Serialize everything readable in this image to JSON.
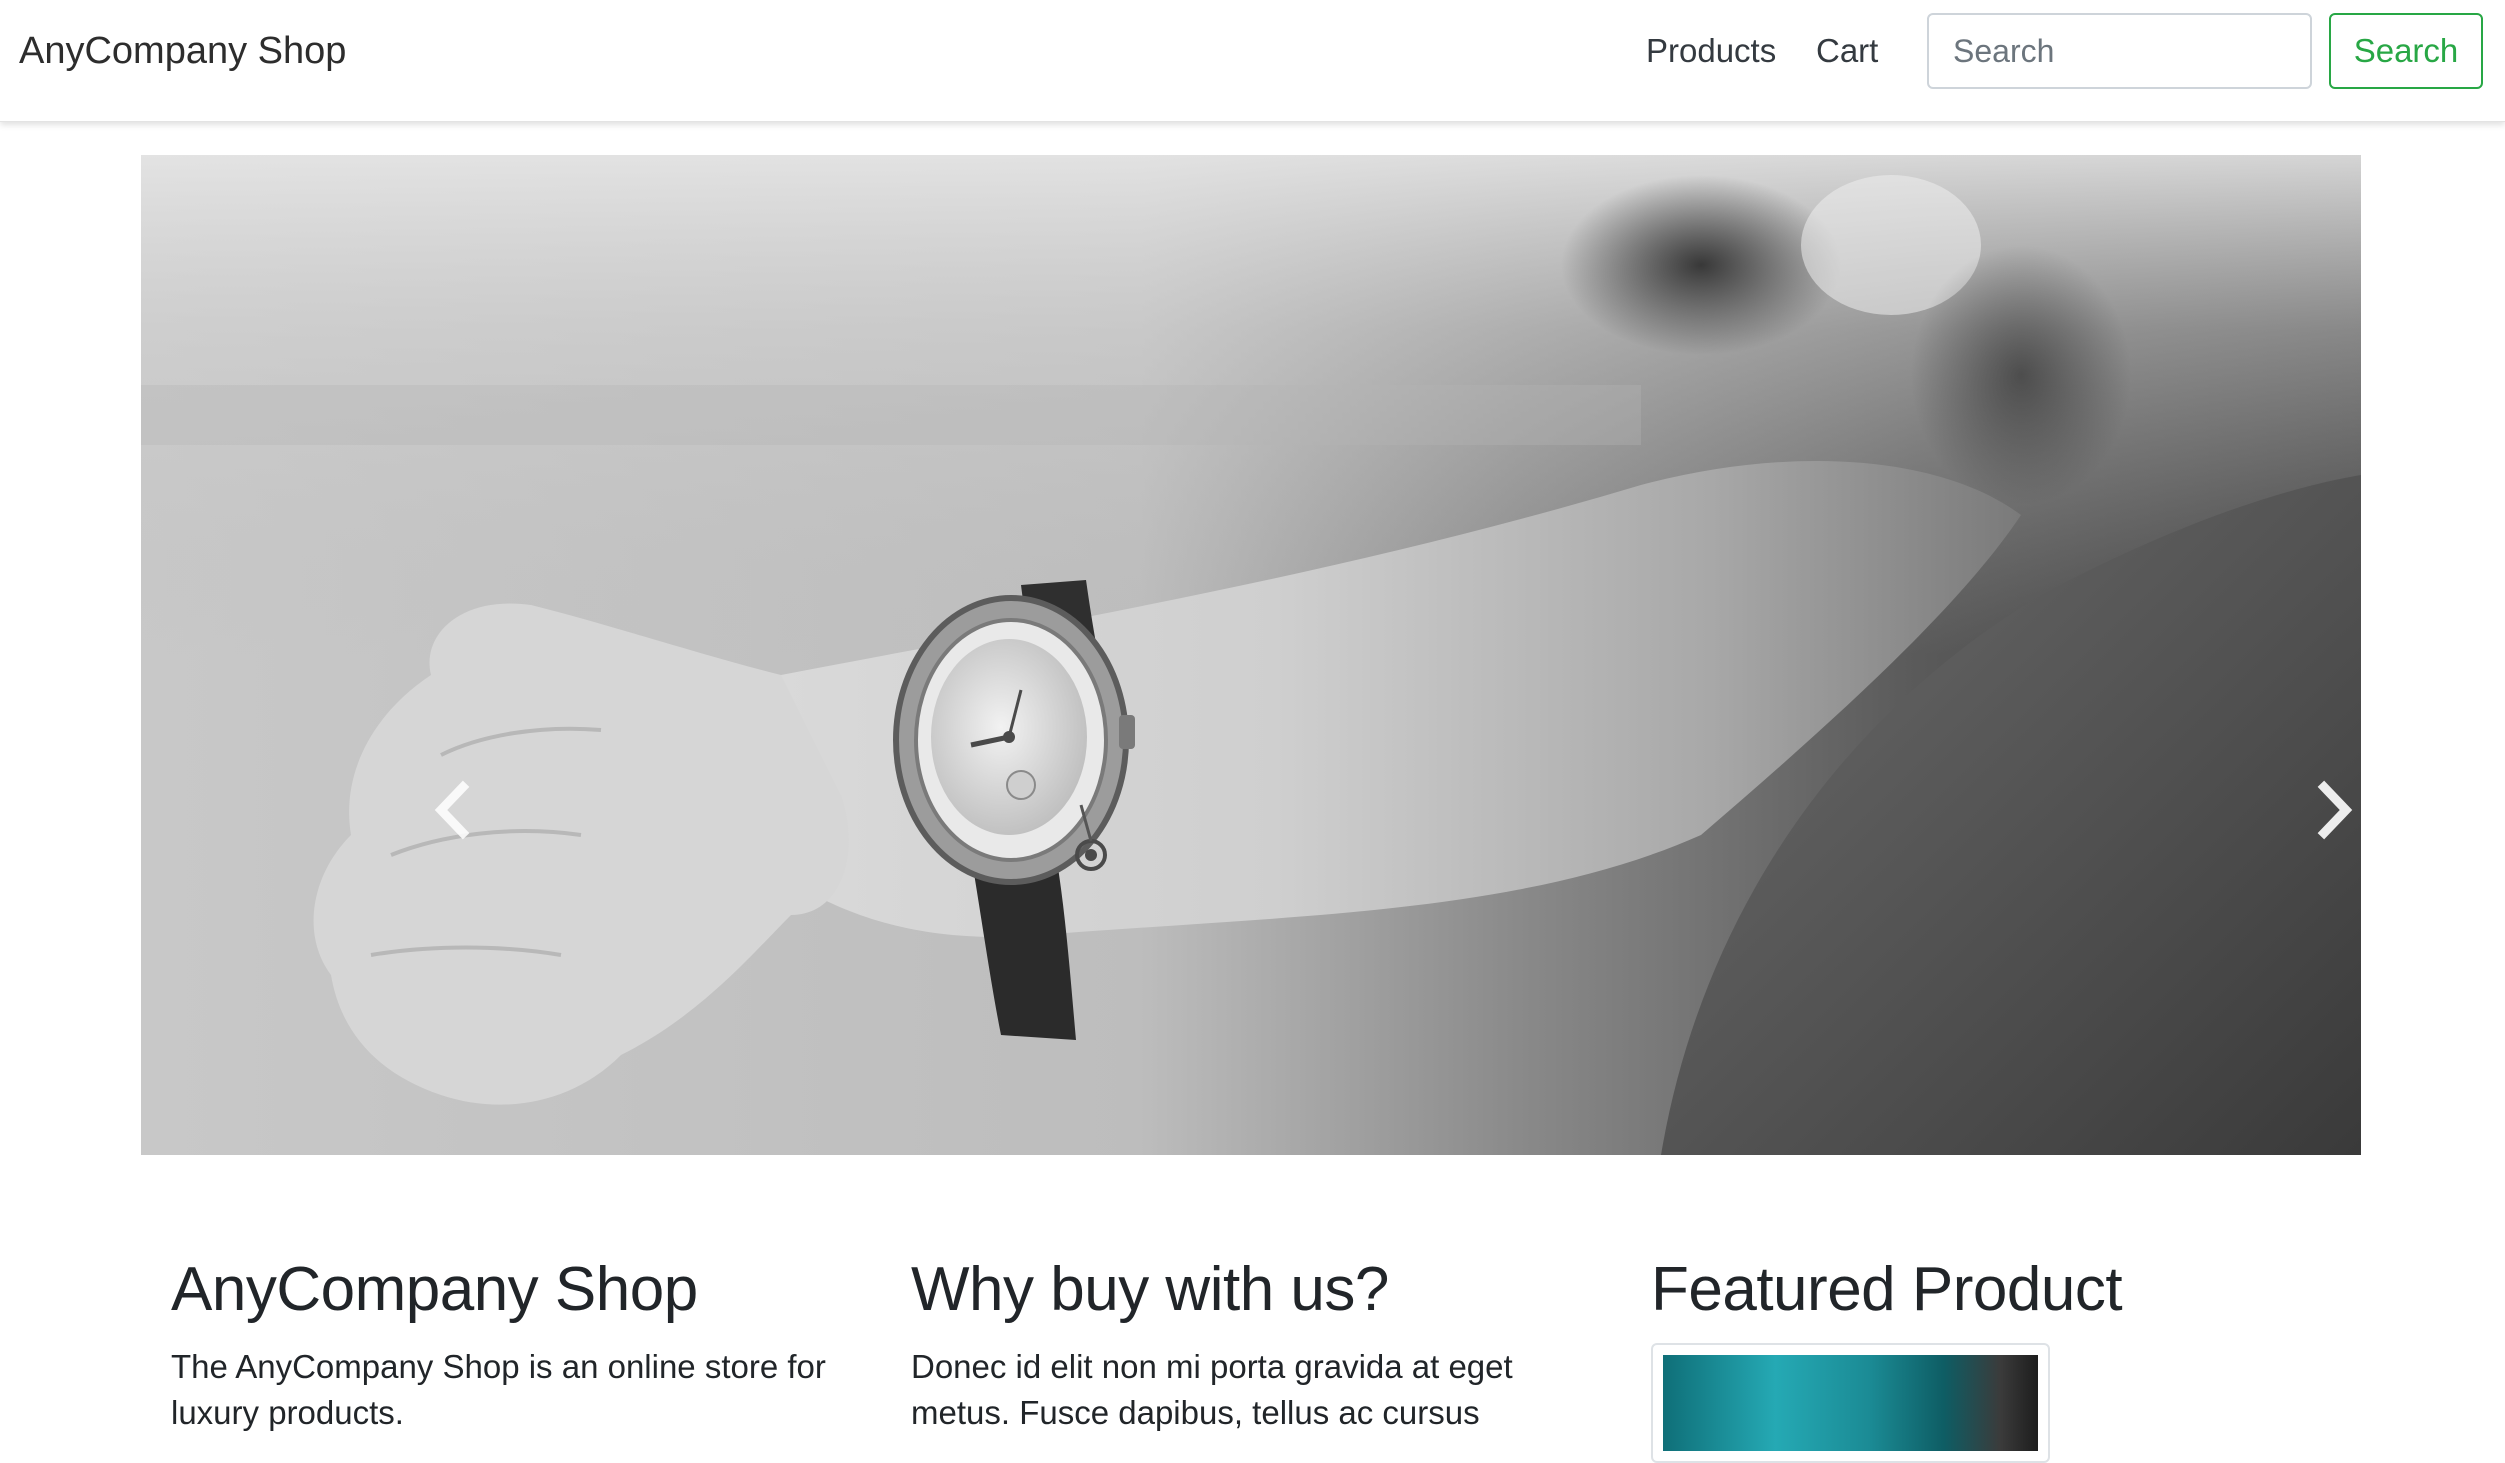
{
  "navbar": {
    "brand": "AnyCompany Shop",
    "links": {
      "products": "Products",
      "cart": "Cart"
    },
    "search": {
      "placeholder": "Search",
      "value": "",
      "button_label": "Search"
    },
    "colors": {
      "accent": "#28a745"
    }
  },
  "carousel": {
    "image_subject": "black-and-white photo of a wristwatch on a woman's wrist",
    "prev_icon": "chevron-left-icon",
    "next_icon": "chevron-right-icon",
    "slide_count": 3,
    "active_slide": 3
  },
  "columns": [
    {
      "heading": "AnyCompany Shop",
      "text": "The AnyCompany Shop is an online store for luxury products."
    },
    {
      "heading": "Why buy with us?",
      "text": "Donec id elit non mi porta gravida at eget metus. Fusce dapibus, tellus ac cursus"
    },
    {
      "heading": "Featured Product",
      "image_subject": "teal product photo"
    }
  ]
}
